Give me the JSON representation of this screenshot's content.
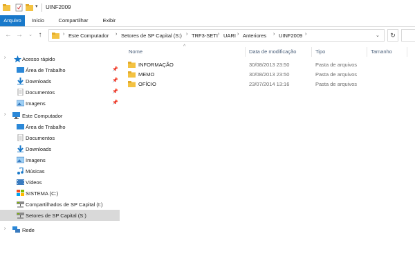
{
  "window": {
    "title": "UINF2009"
  },
  "ribbon": {
    "tabs": [
      {
        "label": "Arquivo",
        "active": true
      },
      {
        "label": "Início",
        "active": false
      },
      {
        "label": "Compartilhar",
        "active": false
      },
      {
        "label": "Exibir",
        "active": false
      }
    ]
  },
  "address": {
    "crumbs": [
      "Este Computador",
      "Setores de SP Capital (S:)",
      "TRF3-SETI",
      "UARI",
      "Anteriores",
      "UINF2009"
    ]
  },
  "sidebar": {
    "items": [
      {
        "label": "Acesso rápido",
        "icon": "star-icon",
        "pinned": false
      },
      {
        "label": "Área de Trabalho",
        "icon": "desktop-icon",
        "pinned": true
      },
      {
        "label": "Downloads",
        "icon": "download-icon",
        "pinned": true
      },
      {
        "label": "Documentos",
        "icon": "document-icon",
        "pinned": true
      },
      {
        "label": "Imagens",
        "icon": "image-icon",
        "pinned": true
      },
      {
        "label": "Este Computador",
        "icon": "computer-icon",
        "pinned": false
      },
      {
        "label": "Área de Trabalho",
        "icon": "desktop-icon",
        "pinned": false
      },
      {
        "label": "Documentos",
        "icon": "document-icon",
        "pinned": false
      },
      {
        "label": "Downloads",
        "icon": "download-icon",
        "pinned": false
      },
      {
        "label": "Imagens",
        "icon": "image-icon",
        "pinned": false
      },
      {
        "label": "Músicas",
        "icon": "music-icon",
        "pinned": false
      },
      {
        "label": "Vídeos",
        "icon": "video-icon",
        "pinned": false
      },
      {
        "label": "SISTEMA (C:)",
        "icon": "drive-icon",
        "pinned": false
      },
      {
        "label": "Compartilhados de SP Capital (I:)",
        "icon": "network-drive-icon",
        "pinned": false
      },
      {
        "label": "Setores de SP Capital (S:)",
        "icon": "network-drive-icon",
        "pinned": false,
        "selected": true
      },
      {
        "label": "Rede",
        "icon": "network-icon",
        "pinned": false
      }
    ]
  },
  "files": {
    "columns": [
      "Nome",
      "Data de modificação",
      "Tipo",
      "Tamanho"
    ],
    "rows": [
      {
        "name": "INFORMAÇÃO",
        "modified": "30/08/2013 23:50",
        "type": "Pasta de arquivos",
        "size": ""
      },
      {
        "name": "MEMO",
        "modified": "30/08/2013 23:50",
        "type": "Pasta de arquivos",
        "size": ""
      },
      {
        "name": "OFÍCIO",
        "modified": "23/07/2014 13:16",
        "type": "Pasta de arquivos",
        "size": ""
      }
    ]
  },
  "colors": {
    "accent": "#1979ca",
    "folder": "#f3c242",
    "selection": "#d9d9d9",
    "header_text": "#4a5f7a"
  }
}
